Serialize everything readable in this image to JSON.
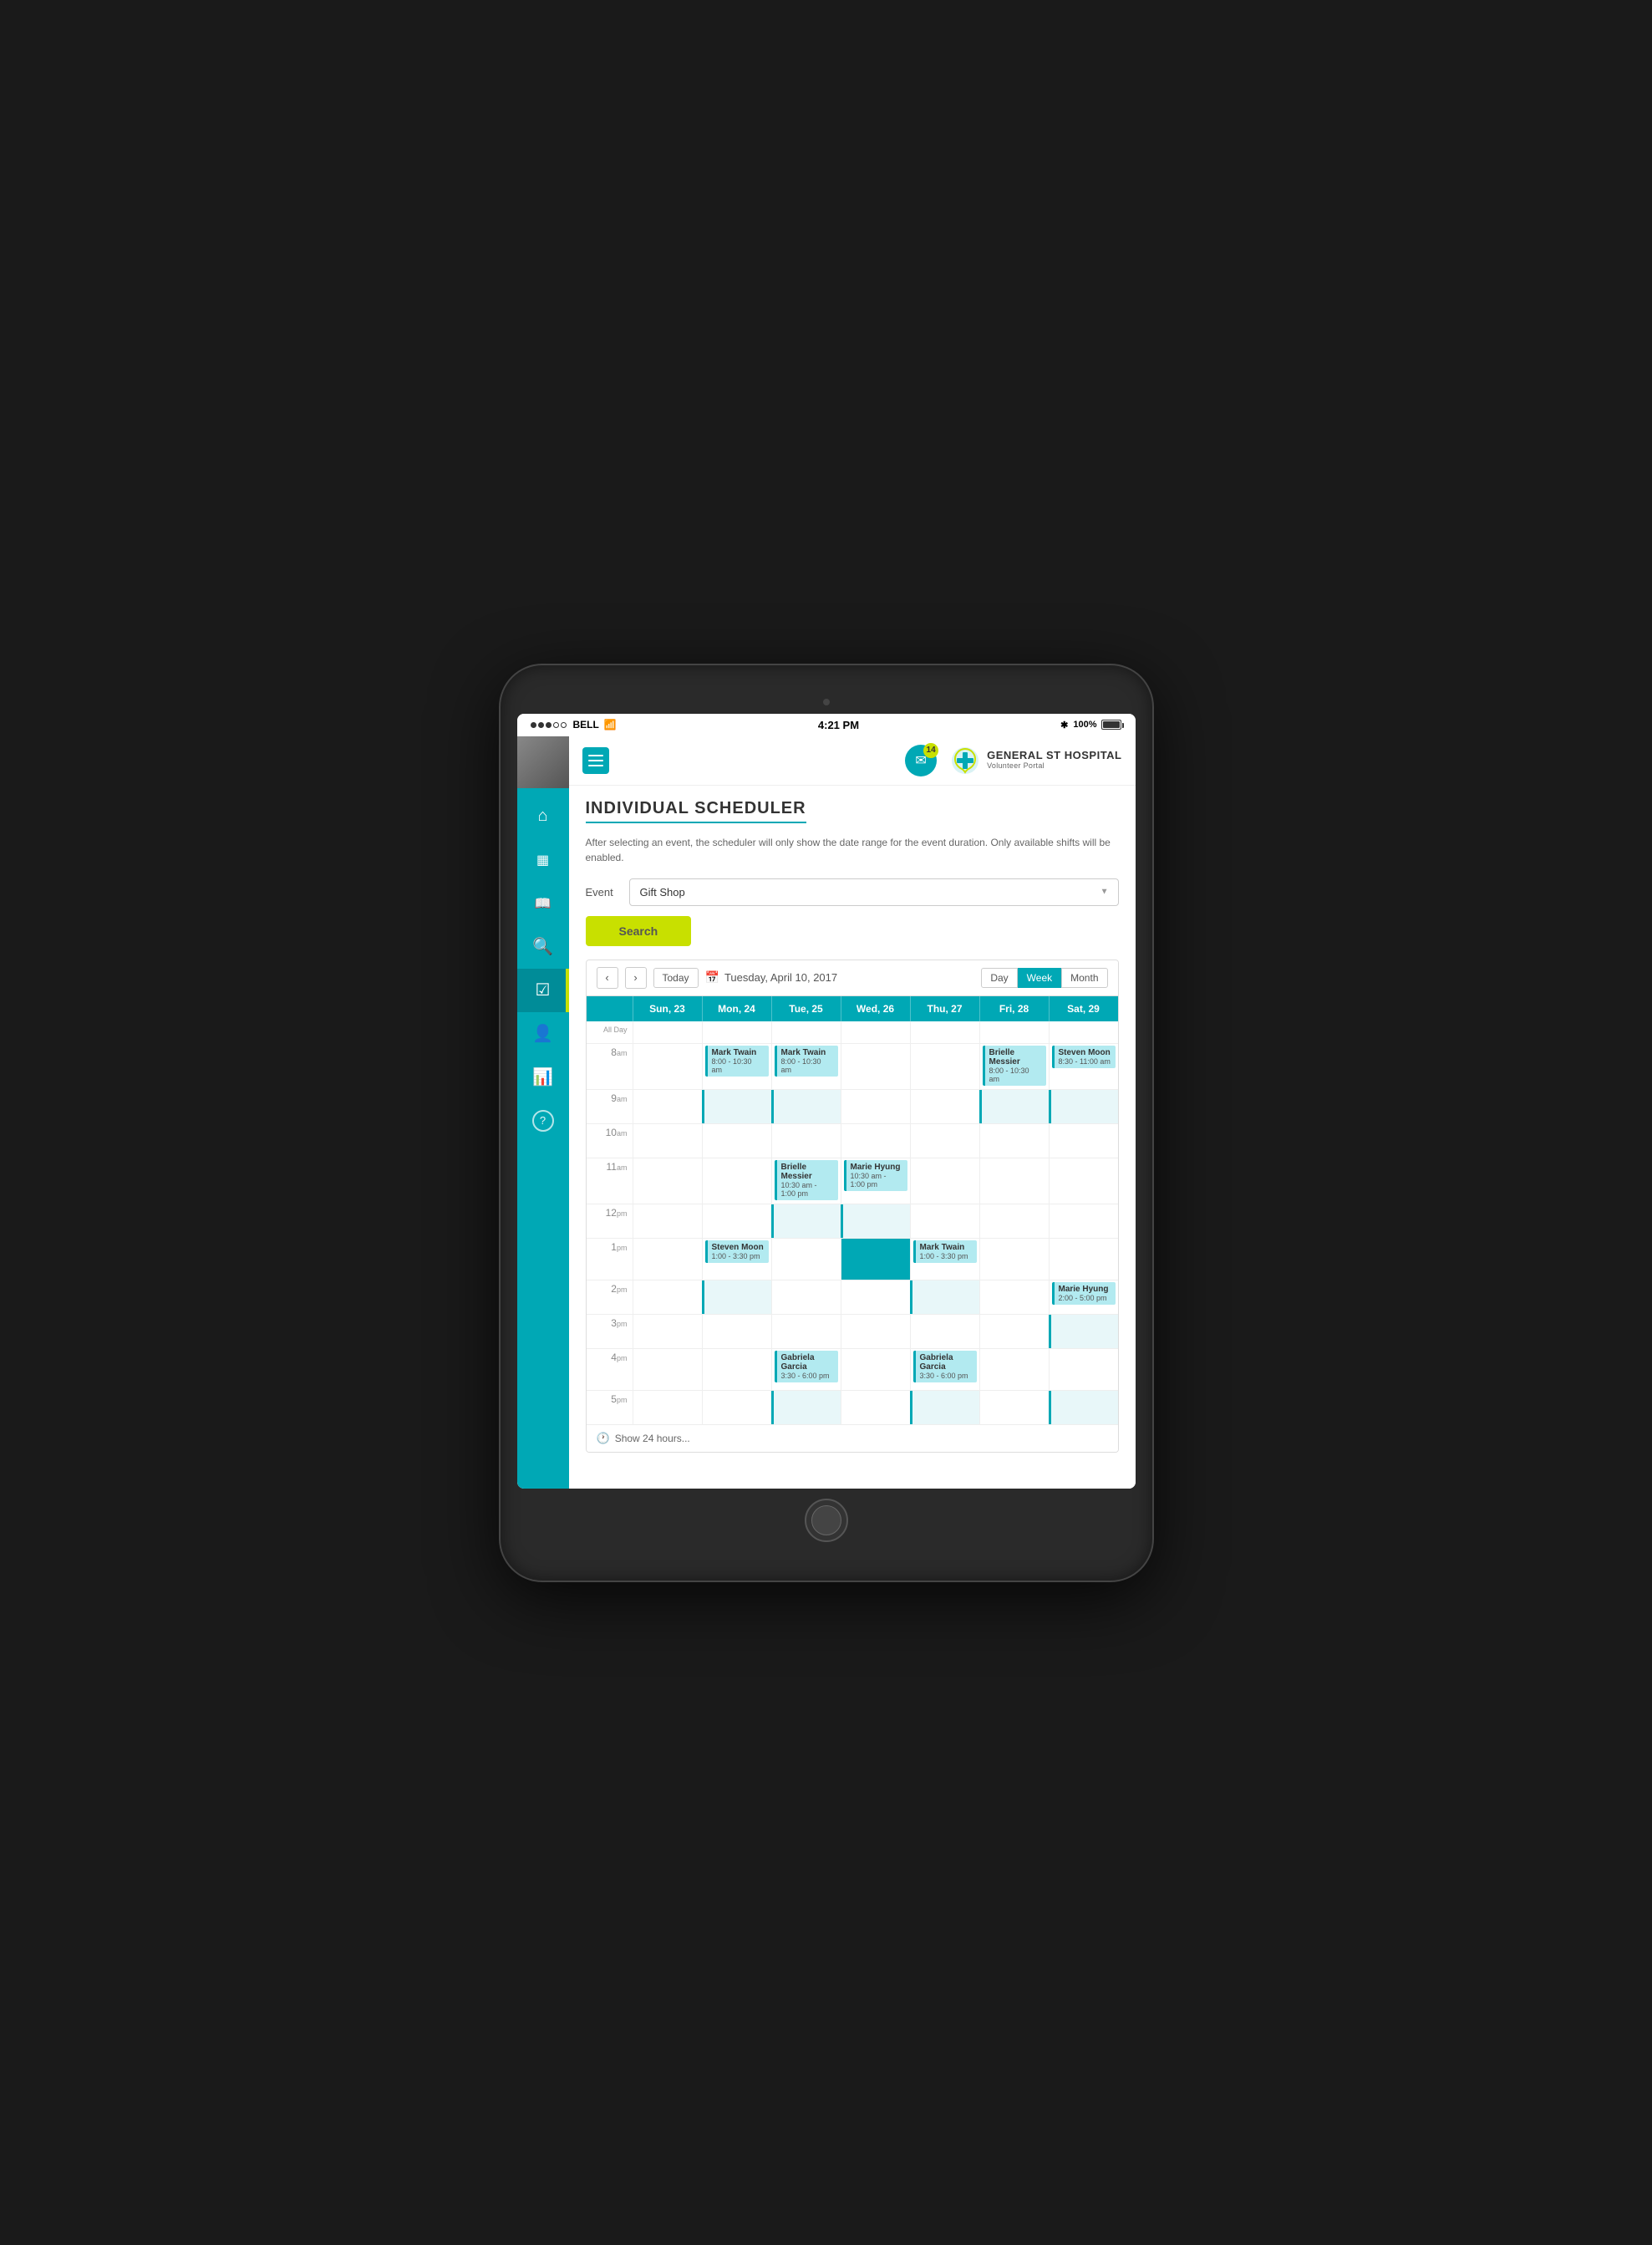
{
  "status_bar": {
    "carrier": "BELL",
    "time": "4:21 PM",
    "battery": "100%",
    "signal_dots": [
      "filled",
      "filled",
      "filled",
      "empty",
      "empty"
    ]
  },
  "header": {
    "hamburger_label": "☰",
    "notification_count": "14",
    "hospital_name": "GENERAL ST HOSPITAL",
    "hospital_sub": "Volunteer Portal"
  },
  "page": {
    "title": "INDIVIDUAL SCHEDULER",
    "description": "After selecting an event, the scheduler will only show the date range for the event duration. Only available shifts will be enabled.",
    "event_label": "Event",
    "event_value": "Gift Shop",
    "search_button": "Search"
  },
  "calendar": {
    "prev_btn": "‹",
    "next_btn": "›",
    "today_btn": "Today",
    "current_date": "Tuesday, April 10, 2017",
    "view_day": "Day",
    "view_week": "Week",
    "view_month": "Month",
    "days": [
      {
        "label": "Sun, 23"
      },
      {
        "label": "Mon, 24"
      },
      {
        "label": "Tue, 25"
      },
      {
        "label": "Wed, 26"
      },
      {
        "label": "Thu, 27"
      },
      {
        "label": "Fri, 28"
      },
      {
        "label": "Sat, 29"
      }
    ],
    "allday_label": "All Day",
    "show_24": "Show 24 hours...",
    "time_slots": [
      {
        "time": "8",
        "ampm": "am"
      },
      {
        "time": "9",
        "ampm": "am"
      },
      {
        "time": "10",
        "ampm": "am"
      },
      {
        "time": "11",
        "ampm": "am"
      },
      {
        "time": "12",
        "ampm": "pm"
      },
      {
        "time": "1",
        "ampm": "pm"
      },
      {
        "time": "2",
        "ampm": "pm"
      },
      {
        "time": "3",
        "ampm": "pm"
      },
      {
        "time": "4",
        "ampm": "pm"
      },
      {
        "time": "5",
        "ampm": "pm"
      }
    ],
    "events": {
      "mon_8am": {
        "name": "Mark Twain",
        "time": "8:00 - 10:30 am"
      },
      "tue_8am": {
        "name": "Mark Twain",
        "time": "8:00 - 10:30 am"
      },
      "fri_8am": {
        "name": "Brielle Messier",
        "time": "8:00 - 10:30 am"
      },
      "sat_8am": {
        "name": "Steven Moon",
        "time": "8:30 - 11:00 am"
      },
      "tue_11am": {
        "name": "Brielle Messier",
        "time": "10:30 am - 1:00 pm"
      },
      "wed_11am": {
        "name": "Marie Hyung",
        "time": "10:30 am - 1:00 pm"
      },
      "mon_1pm": {
        "name": "Steven Moon",
        "time": "1:00 - 3:30 pm"
      },
      "thu_1pm": {
        "name": "Mark Twain",
        "time": "1:00 - 3:30 pm"
      },
      "sat_2pm": {
        "name": "Marie Hyung",
        "time": "2:00 - 5:00 pm"
      },
      "tue_4pm": {
        "name": "Gabriela Garcia",
        "time": "3:30 - 6:00 pm"
      },
      "thu_4pm": {
        "name": "Gabriela Garcia",
        "time": "3:30 - 6:00 pm"
      }
    }
  },
  "sidebar": {
    "items": [
      {
        "icon": "🏠",
        "name": "home"
      },
      {
        "icon": "📅",
        "name": "calendar"
      },
      {
        "icon": "📖",
        "name": "book"
      },
      {
        "icon": "🔍",
        "name": "search"
      },
      {
        "icon": "✅",
        "name": "scheduler",
        "active": true
      },
      {
        "icon": "👤",
        "name": "profile"
      },
      {
        "icon": "📊",
        "name": "reports"
      },
      {
        "icon": "❓",
        "name": "help"
      }
    ]
  }
}
